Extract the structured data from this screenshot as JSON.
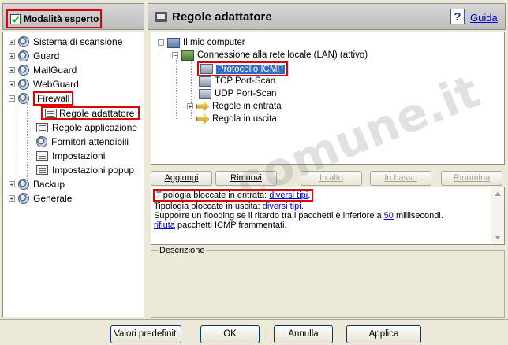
{
  "left": {
    "expert_mode_label": "Modalità esperto",
    "tree": [
      {
        "label": "Sistema di scansione"
      },
      {
        "label": "Guard"
      },
      {
        "label": "MailGuard"
      },
      {
        "label": "WebGuard"
      },
      {
        "label": "Firewall"
      },
      {
        "label": "Regole adattatore"
      },
      {
        "label": "Regole applicazione"
      },
      {
        "label": "Fornitori attendibili"
      },
      {
        "label": "Impostazioni"
      },
      {
        "label": "Impostazioni popup"
      },
      {
        "label": "Backup"
      },
      {
        "label": "Generale"
      }
    ]
  },
  "header": {
    "title": "Regole adattatore",
    "help_label": "Guida"
  },
  "rule_tree": {
    "computer": "Il mio computer",
    "connection": "Connessione alla rete locale (LAN) (attivo)",
    "items": [
      "Protocollo ICMP",
      "TCP Port-Scan",
      "UDP Port-Scan",
      "Regole in entrata",
      "Regola in uscita"
    ]
  },
  "buttons": {
    "add": "Aggiungi",
    "remove": "Rimuovi",
    "up": "In alto",
    "down": "In basso",
    "rename": "Rinomina"
  },
  "info": {
    "line1_prefix": "Tipologia bloccate in entrata: ",
    "line1_link": "diversi tipi",
    "line1_suffix": ".",
    "line2_prefix": "Tipologia bloccate in uscita: ",
    "line2_link": "diversi tipi",
    "line2_suffix": ".",
    "line3_prefix": "Supporre un flooding se il ritardo tra i pacchetti è inferiore a ",
    "line3_link": "50",
    "line3_suffix": " millisecondi.",
    "line4_link": "rifiuta",
    "line4_suffix": " pacchetti ICMP frammentati."
  },
  "description_label": "Descrizione",
  "footer": {
    "defaults": "Valori predefiniti",
    "ok": "OK",
    "cancel": "Annulla",
    "apply": "Applica"
  },
  "watermark": "comune.it",
  "colors": {
    "highlight_red": "#e00000",
    "selection_blue": "#316ac5",
    "link_blue": "#0000d8"
  }
}
